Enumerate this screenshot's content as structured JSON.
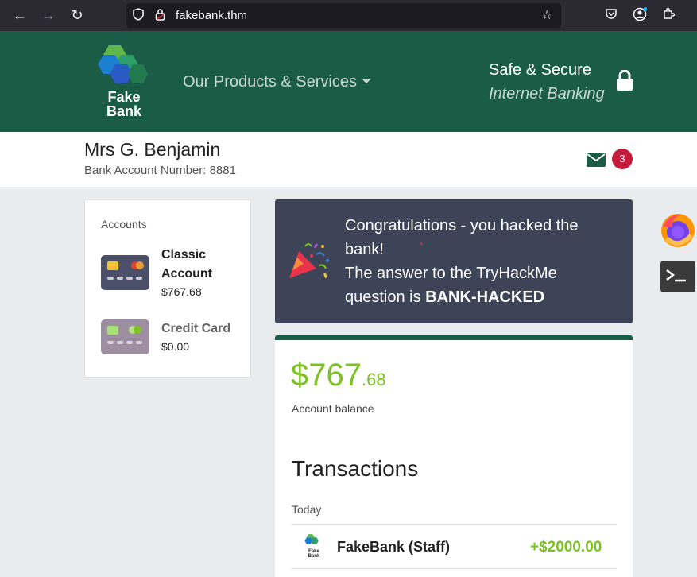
{
  "browser": {
    "url": "fakebank.thm",
    "icons": [
      "back-arrow-icon",
      "forward-arrow-icon",
      "reload-icon",
      "shield-icon",
      "lock-icon",
      "star-icon",
      "pocket-icon",
      "account-icon",
      "extensions-icon"
    ]
  },
  "header": {
    "logo_text_line1": "Fake",
    "logo_text_line2": "Bank",
    "products_menu": "Our Products & Services",
    "safe_line1": "Safe & Secure",
    "safe_line2": "Internet Banking"
  },
  "user": {
    "name": "Mrs G. Benjamin",
    "account_number": "Bank Account Number: 8881",
    "messages_count": "3"
  },
  "accounts": {
    "title": "Accounts",
    "items": [
      {
        "name": "Classic Account",
        "balance": "$767.68"
      },
      {
        "name": "Credit Card",
        "balance": "$0.00"
      }
    ]
  },
  "congrats": {
    "line1": "Congratulations - you hacked the bank!",
    "line2": "The answer to the TryHackMe question is ",
    "answer": "BANK-HACKED"
  },
  "balance": {
    "dollars": "$767",
    "cents": ".68",
    "label": "Account balance"
  },
  "transactions": {
    "heading": "Transactions",
    "day": "Today",
    "rows": [
      {
        "logo_line1": "Fake",
        "logo_line2": "Bank",
        "name": "FakeBank (Staff)",
        "amount": "+$2000.00"
      }
    ]
  },
  "colors": {
    "header_green": "#1a5c46",
    "accent_green": "#7cc224",
    "panel_dark": "#3e4458",
    "badge_red": "#c51c3c"
  }
}
